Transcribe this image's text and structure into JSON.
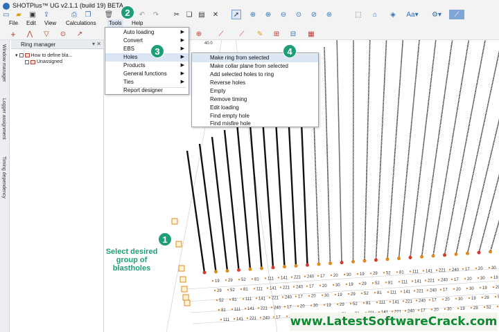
{
  "window": {
    "title": "SHOTPlus™ UG v2.1.1 (build 19) BETA"
  },
  "menubar": {
    "items": [
      "File",
      "Edit",
      "View",
      "Calculations",
      "Tools",
      "Help"
    ]
  },
  "side_tabs": [
    "Window manager",
    "Logger assignment",
    "Timing dependency"
  ],
  "ring_manager": {
    "title": "Ring manager",
    "tree": [
      {
        "label": "How to define bla...",
        "checked": true
      },
      {
        "label": "Unassigned",
        "checked": true
      }
    ]
  },
  "tools_menu": {
    "items": [
      {
        "label": "Auto loading",
        "submenu": true
      },
      {
        "label": "Convert",
        "submenu": true
      },
      {
        "label": "EBS",
        "submenu": true
      },
      {
        "label": "Holes",
        "submenu": true,
        "highlight": true
      },
      {
        "label": "Products",
        "submenu": true
      },
      {
        "label": "General functions",
        "submenu": true
      },
      {
        "label": "Ties",
        "submenu": true
      },
      {
        "label": "Report designer",
        "submenu": false
      }
    ]
  },
  "holes_submenu": {
    "items": [
      {
        "label": "Make ring from selected",
        "highlight": true
      },
      {
        "label": "Make collar plane from selected"
      },
      {
        "label": "Add selected holes to ring"
      },
      {
        "label": "Reverse holes"
      },
      {
        "label": "Empty"
      },
      {
        "label": "Remove timing"
      },
      {
        "label": "Edit loading"
      },
      {
        "label": "Find empty hole"
      },
      {
        "label": "Find misfire hole"
      }
    ]
  },
  "steps": {
    "s1": "1",
    "s2": "2",
    "s3": "3",
    "s4": "4"
  },
  "annotation": "Select desired group of blastholes",
  "canvas": {
    "ruler_label": "40.0",
    "tick_labels": [
      "19",
      "29",
      "52",
      "81",
      "111",
      "141",
      "221",
      "240",
      "17",
      "20",
      "30"
    ]
  },
  "watermark": "www.LatestSoftwareCrack.com",
  "colors": {
    "accent": "#1e9e78",
    "watermark": "#0b8a2f",
    "hole": "#e08a1e"
  }
}
